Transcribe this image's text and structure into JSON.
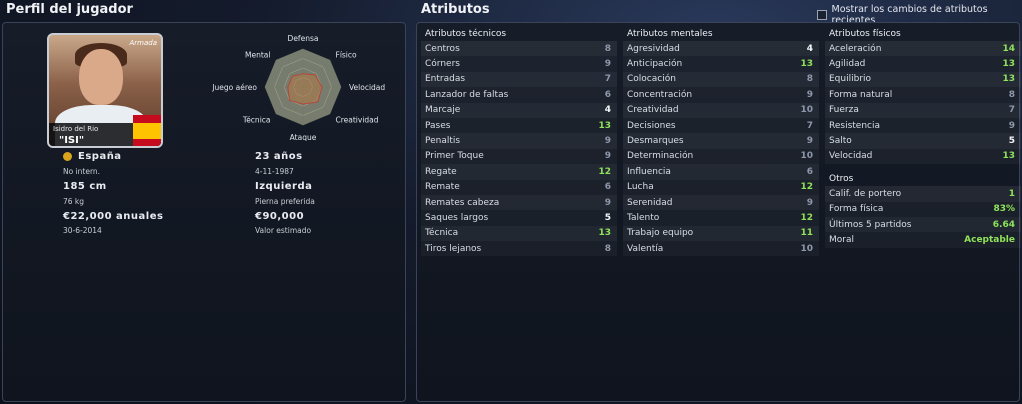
{
  "profile": {
    "title": "Perfil del jugador",
    "photo": {
      "name": "Isidro del Rio",
      "nickname": "\"ISI\"",
      "logo": "Armada"
    },
    "radar": {
      "labels": [
        "Defensa",
        "Físico",
        "Velocidad",
        "Creatividad",
        "Ataque",
        "Técnica",
        "Juego aéreo",
        "Mental"
      ],
      "values": [
        0.35,
        0.45,
        0.5,
        0.55,
        0.45,
        0.5,
        0.4,
        0.4
      ]
    },
    "nation": "España",
    "intl": "No intern.",
    "height": "185 cm",
    "weight": "76 kg",
    "wage": "€22,000 anuales",
    "contract": "30-6-2014",
    "age": "23 años",
    "dob": "4-11-1987",
    "foot": "Izquierda",
    "foot_label": "Pierna preferida",
    "value": "€90,000",
    "value_label": "Valor estimado"
  },
  "attributes": {
    "title": "Atributos",
    "show_changes": "Mostrar los cambios de atributos recientes",
    "technical": {
      "header": "Atributos técnicos",
      "items": [
        [
          "Centros",
          "8",
          "gray"
        ],
        [
          "Córners",
          "9",
          "gray"
        ],
        [
          "Entradas",
          "7",
          "gray"
        ],
        [
          "Lanzador de faltas",
          "6",
          "gray"
        ],
        [
          "Marcaje",
          "4",
          "white"
        ],
        [
          "Pases",
          "13",
          "green"
        ],
        [
          "Penaltis",
          "9",
          "gray"
        ],
        [
          "Primer Toque",
          "9",
          "gray"
        ],
        [
          "Regate",
          "12",
          "green"
        ],
        [
          "Remate",
          "6",
          "gray"
        ],
        [
          "Remates cabeza",
          "9",
          "gray"
        ],
        [
          "Saques largos",
          "5",
          "white"
        ],
        [
          "Técnica",
          "13",
          "green"
        ],
        [
          "Tiros lejanos",
          "8",
          "gray"
        ]
      ]
    },
    "mental": {
      "header": "Atributos mentales",
      "items": [
        [
          "Agresividad",
          "4",
          "white"
        ],
        [
          "Anticipación",
          "13",
          "green"
        ],
        [
          "Colocación",
          "8",
          "gray"
        ],
        [
          "Concentración",
          "9",
          "gray"
        ],
        [
          "Creatividad",
          "10",
          "gray"
        ],
        [
          "Decisiones",
          "7",
          "gray"
        ],
        [
          "Desmarques",
          "9",
          "gray"
        ],
        [
          "Determinación",
          "10",
          "gray"
        ],
        [
          "Influencia",
          "6",
          "gray"
        ],
        [
          "Lucha",
          "12",
          "green"
        ],
        [
          "Serenidad",
          "9",
          "gray"
        ],
        [
          "Talento",
          "12",
          "green"
        ],
        [
          "Trabajo equipo",
          "11",
          "green"
        ],
        [
          "Valentía",
          "10",
          "gray"
        ]
      ]
    },
    "physical": {
      "header": "Atributos físicos",
      "items": [
        [
          "Aceleración",
          "14",
          "green"
        ],
        [
          "Agilidad",
          "13",
          "green"
        ],
        [
          "Equilibrio",
          "13",
          "green"
        ],
        [
          "Forma natural",
          "8",
          "gray"
        ],
        [
          "Fuerza",
          "7",
          "gray"
        ],
        [
          "Resistencia",
          "9",
          "gray"
        ],
        [
          "Salto",
          "5",
          "white"
        ],
        [
          "Velocidad",
          "13",
          "green"
        ]
      ]
    },
    "others": {
      "header": "Otros",
      "items": [
        [
          "Calif. de portero",
          "1",
          "green"
        ],
        [
          "Forma física",
          "83%",
          "green"
        ],
        [
          "Últimos 5 partidos",
          "6.64",
          "green"
        ],
        [
          "Moral",
          "Aceptable",
          "green"
        ]
      ]
    }
  }
}
